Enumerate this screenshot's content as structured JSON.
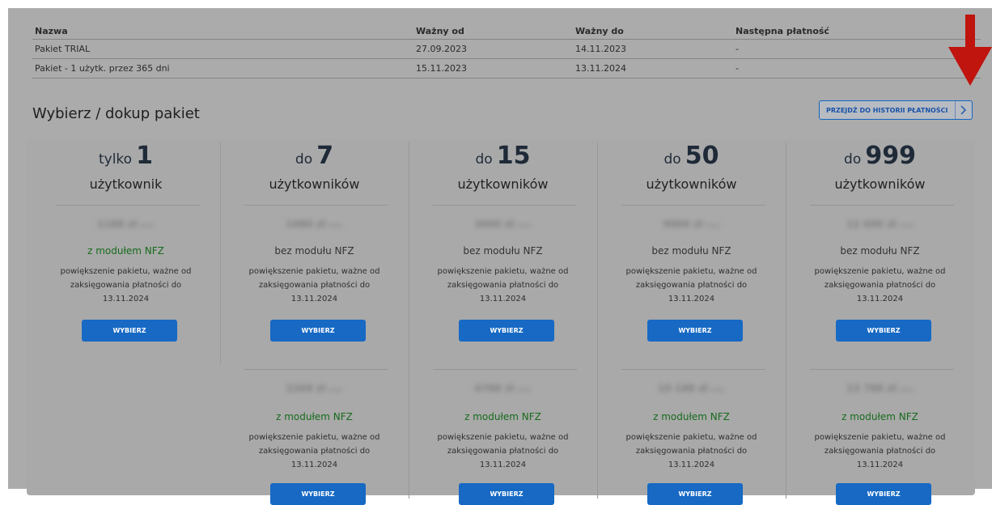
{
  "table": {
    "headers": [
      "Nazwa",
      "Ważny od",
      "Ważny do",
      "Następna płatność"
    ],
    "rows": [
      [
        "Pakiet TRIAL",
        "27.09.2023",
        "14.11.2023",
        "-"
      ],
      [
        "Pakiet - 1 użytk. przez 365 dni",
        "15.11.2023",
        "13.11.2024",
        "-"
      ]
    ]
  },
  "section": {
    "title": "Wybierz / dokup pakiet",
    "history_button": "PRZEJDŹ DO HISTORII PŁATNOŚCI"
  },
  "icons": {
    "arrow": "red-down-arrow-icon",
    "chevron": "chevron-right-icon"
  },
  "colors": {
    "accent": "#1769c4",
    "nfz_green": "#176b1d",
    "arrow_red": "#c0140e"
  },
  "packages": [
    {
      "prefix": "tylko",
      "count": "1",
      "users_label": "użytkownik",
      "options": [
        {
          "price": "1188 zł",
          "unit": "netto",
          "module": "z modułem NFZ",
          "desc1": "powiększenie pakietu, ważne od",
          "desc2": "zaksięgowania płatności do",
          "desc3": "13.11.2024",
          "button": "WYBIERZ"
        }
      ]
    },
    {
      "prefix": "do",
      "count": "7",
      "users_label": "użytkowników",
      "options": [
        {
          "price": "1080 zł",
          "unit": "netto",
          "module": "bez modułu NFZ",
          "desc1": "powiększenie pakietu, ważne od",
          "desc2": "zaksięgowania płatności do",
          "desc3": "13.11.2024",
          "button": "WYBIERZ"
        },
        {
          "price": "2268 zł",
          "unit": "netto",
          "module": "z modułem NFZ",
          "desc1": "powiększenie pakietu, ważne od",
          "desc2": "zaksięgowania płatności do",
          "desc3": "13.11.2024",
          "button": "WYBIERZ"
        }
      ]
    },
    {
      "prefix": "do",
      "count": "15",
      "users_label": "użytkowników",
      "options": [
        {
          "price": "3600 zł",
          "unit": "netto",
          "module": "bez modułu NFZ",
          "desc1": "powiększenie pakietu, ważne od",
          "desc2": "zaksięgowania płatności do",
          "desc3": "13.11.2024",
          "button": "WYBIERZ"
        },
        {
          "price": "4788 zł",
          "unit": "netto",
          "module": "z modułem NFZ",
          "desc1": "powiększenie pakietu, ważne od",
          "desc2": "zaksięgowania płatności do",
          "desc3": "13.11.2024",
          "button": "WYBIERZ"
        }
      ]
    },
    {
      "prefix": "do",
      "count": "50",
      "users_label": "użytkowników",
      "options": [
        {
          "price": "9000 zł",
          "unit": "netto",
          "module": "bez modułu NFZ",
          "desc1": "powiększenie pakietu, ważne od",
          "desc2": "zaksięgowania płatności do",
          "desc3": "13.11.2024",
          "button": "WYBIERZ"
        },
        {
          "price": "10 188 zł",
          "unit": "netto",
          "module": "z modułem NFZ",
          "desc1": "powiększenie pakietu, ważne od",
          "desc2": "zaksięgowania płatności do",
          "desc3": "13.11.2024",
          "button": "WYBIERZ"
        }
      ]
    },
    {
      "prefix": "do",
      "count": "999",
      "users_label": "użytkowników",
      "options": [
        {
          "price": "12 600 zł",
          "unit": "netto",
          "module": "bez modułu NFZ",
          "desc1": "powiększenie pakietu, ważne od",
          "desc2": "zaksięgowania płatności do",
          "desc3": "13.11.2024",
          "button": "WYBIERZ"
        },
        {
          "price": "13 788 zł",
          "unit": "netto",
          "module": "z modułem NFZ",
          "desc1": "powiększenie pakietu, ważne od",
          "desc2": "zaksięgowania płatności do",
          "desc3": "13.11.2024",
          "button": "WYBIERZ"
        }
      ]
    }
  ]
}
